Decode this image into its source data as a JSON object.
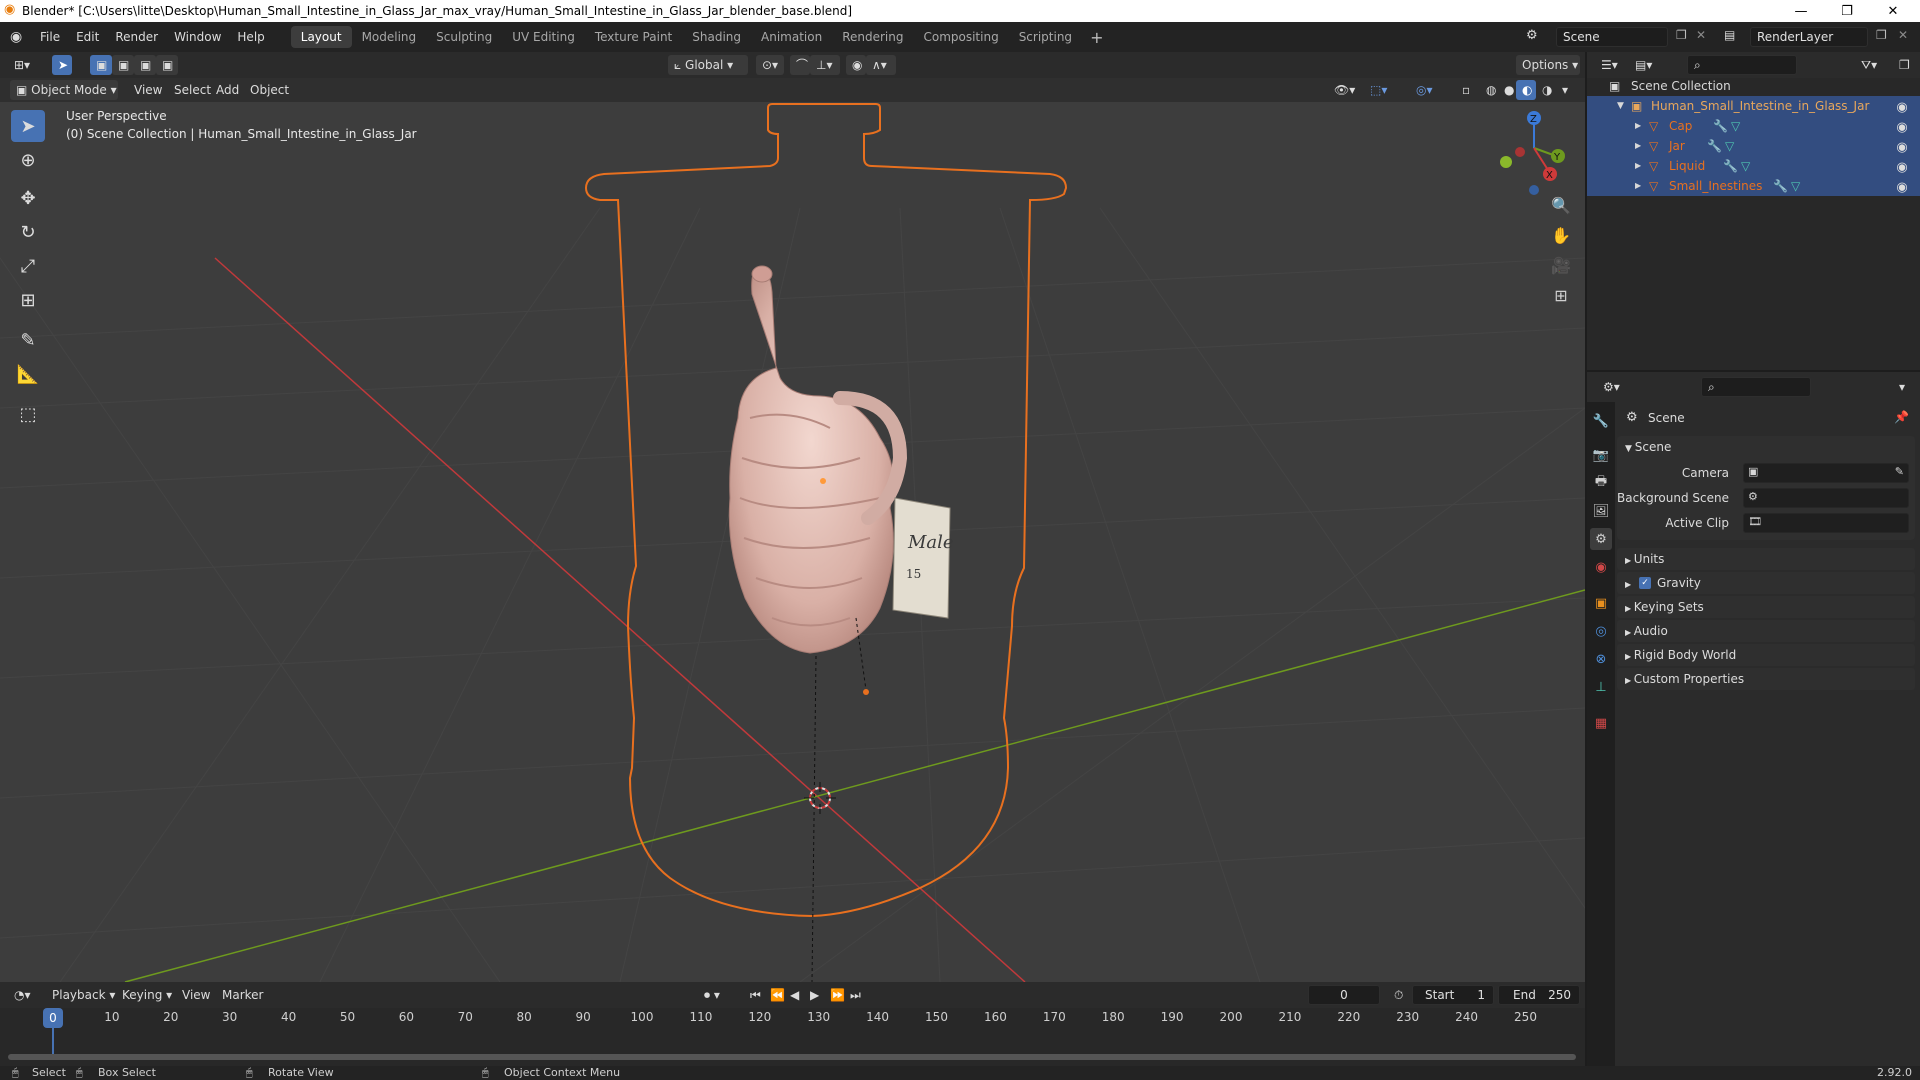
{
  "window": {
    "title": "Blender* [C:\\Users\\litte\\Desktop\\Human_Small_Intestine_in_Glass_Jar_max_vray/Human_Small_Intestine_in_Glass_Jar_blender_base.blend]",
    "controls": [
      "—",
      "❐",
      "✕"
    ]
  },
  "menu": [
    "File",
    "Edit",
    "Render",
    "Window",
    "Help"
  ],
  "workspaces": [
    "Layout",
    "Modeling",
    "Sculpting",
    "UV Editing",
    "Texture Paint",
    "Shading",
    "Animation",
    "Rendering",
    "Compositing",
    "Scripting"
  ],
  "active_workspace": "Layout",
  "scene_name": "Scene",
  "render_layer": "RenderLayer",
  "header": {
    "transform_orientation": "Global",
    "options_label": "Options",
    "mode": "Object Mode",
    "menus": [
      "View",
      "Select",
      "Add",
      "Object"
    ]
  },
  "viewport": {
    "perspective": "User Perspective",
    "collection_path": "(0) Scene Collection | Human_Small_Intestine_in_Glass_Jar",
    "label_text": "Male",
    "label_number": "15"
  },
  "gizmo": {
    "x": "X",
    "y": "Y",
    "z": "Z"
  },
  "outliner": {
    "root": "Scene Collection",
    "collection": "Human_Small_Intestine_in_Glass_Jar",
    "objects": [
      "Cap",
      "Jar",
      "Liquid",
      "Small_Inestines"
    ]
  },
  "properties": {
    "context": "Scene",
    "panel_title": "Scene",
    "fields": [
      {
        "label": "Camera",
        "value": ""
      },
      {
        "label": "Background Scene",
        "value": ""
      },
      {
        "label": "Active Clip",
        "value": ""
      }
    ],
    "sections": [
      "Units",
      "Gravity",
      "Keying Sets",
      "Audio",
      "Rigid Body World",
      "Custom Properties"
    ],
    "gravity_checked": true
  },
  "timeline": {
    "menus": [
      "Playback",
      "Keying",
      "View",
      "Marker"
    ],
    "current_frame": "0",
    "start_label": "Start",
    "start": "1",
    "end_label": "End",
    "end": "250",
    "ticks": [
      "0",
      "10",
      "20",
      "30",
      "40",
      "50",
      "60",
      "70",
      "80",
      "90",
      "100",
      "110",
      "120",
      "130",
      "140",
      "150",
      "160",
      "170",
      "180",
      "190",
      "200",
      "210",
      "220",
      "230",
      "240",
      "250"
    ]
  },
  "status": {
    "select": "Select",
    "box_select": "Box Select",
    "rotate": "Rotate View",
    "context_menu": "Object Context Menu",
    "version": "2.92.0"
  },
  "colors": {
    "selection_orange": "#e8701f",
    "accent_blue": "#4772b3",
    "x_axis": "#c0393b",
    "y_axis": "#6e9a1e"
  }
}
